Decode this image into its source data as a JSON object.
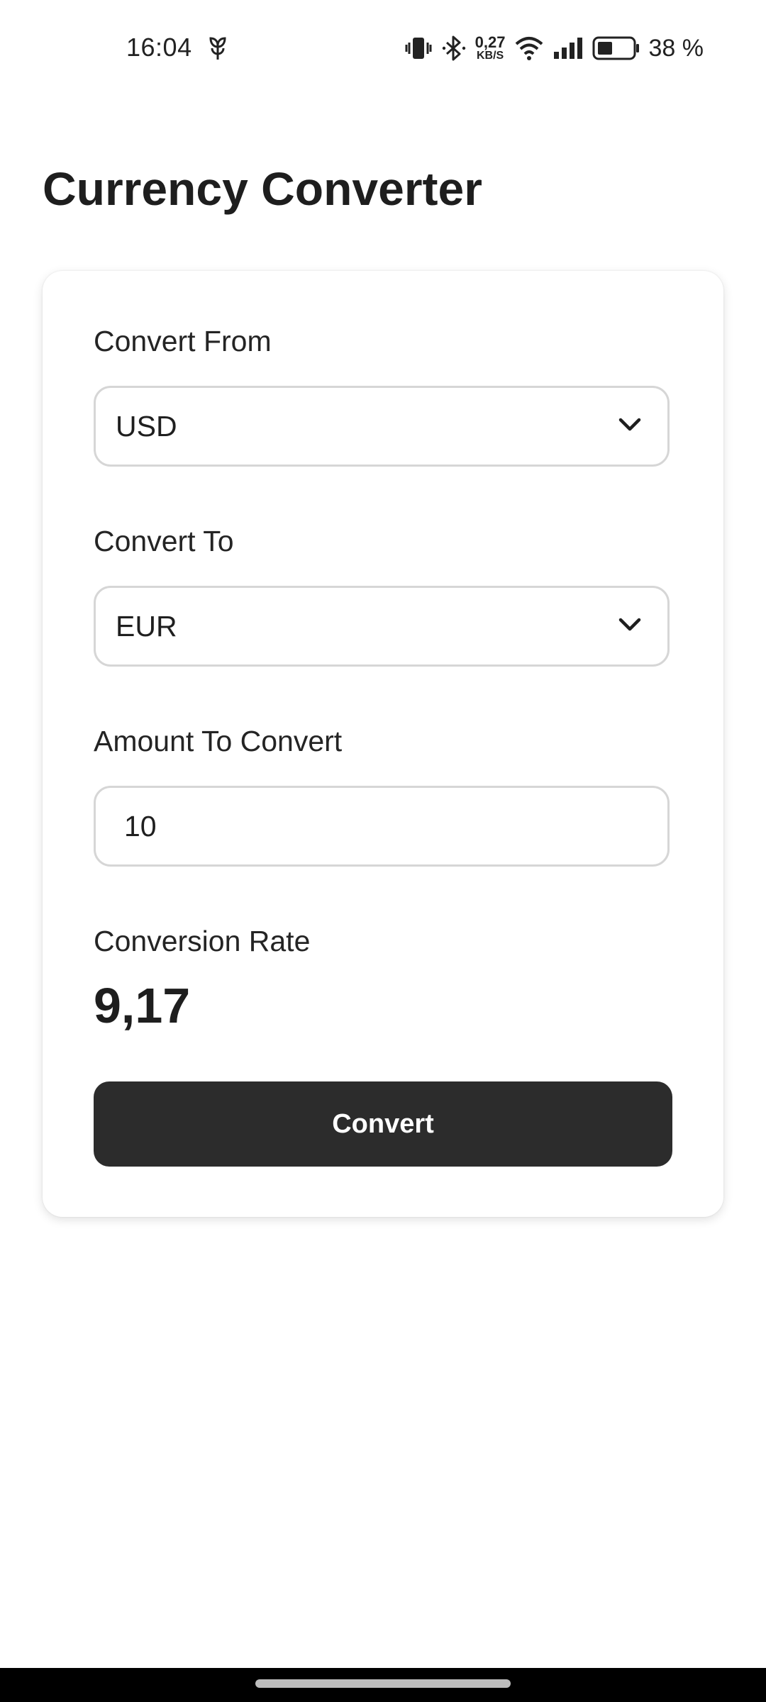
{
  "status_bar": {
    "time": "16:04",
    "net_speed_value": "0,27",
    "net_speed_unit": "KB/S",
    "battery_percent": "38 %",
    "icons": [
      "notification-plant-icon",
      "vibrate-icon",
      "bluetooth-icon",
      "wifi-icon",
      "signal-icon",
      "battery-icon"
    ]
  },
  "page": {
    "title": "Currency Converter"
  },
  "form": {
    "from_label": "Convert From",
    "from_value": "USD",
    "to_label": "Convert To",
    "to_value": "EUR",
    "amount_label": "Amount To Convert",
    "amount_value": "10",
    "rate_label": "Conversion Rate",
    "rate_value": "9,17",
    "convert_label": "Convert"
  },
  "colors": {
    "button_bg": "#2c2c2c",
    "button_text": "#ffffff",
    "field_border": "#d6d6d6",
    "text": "#1f1f1f"
  }
}
